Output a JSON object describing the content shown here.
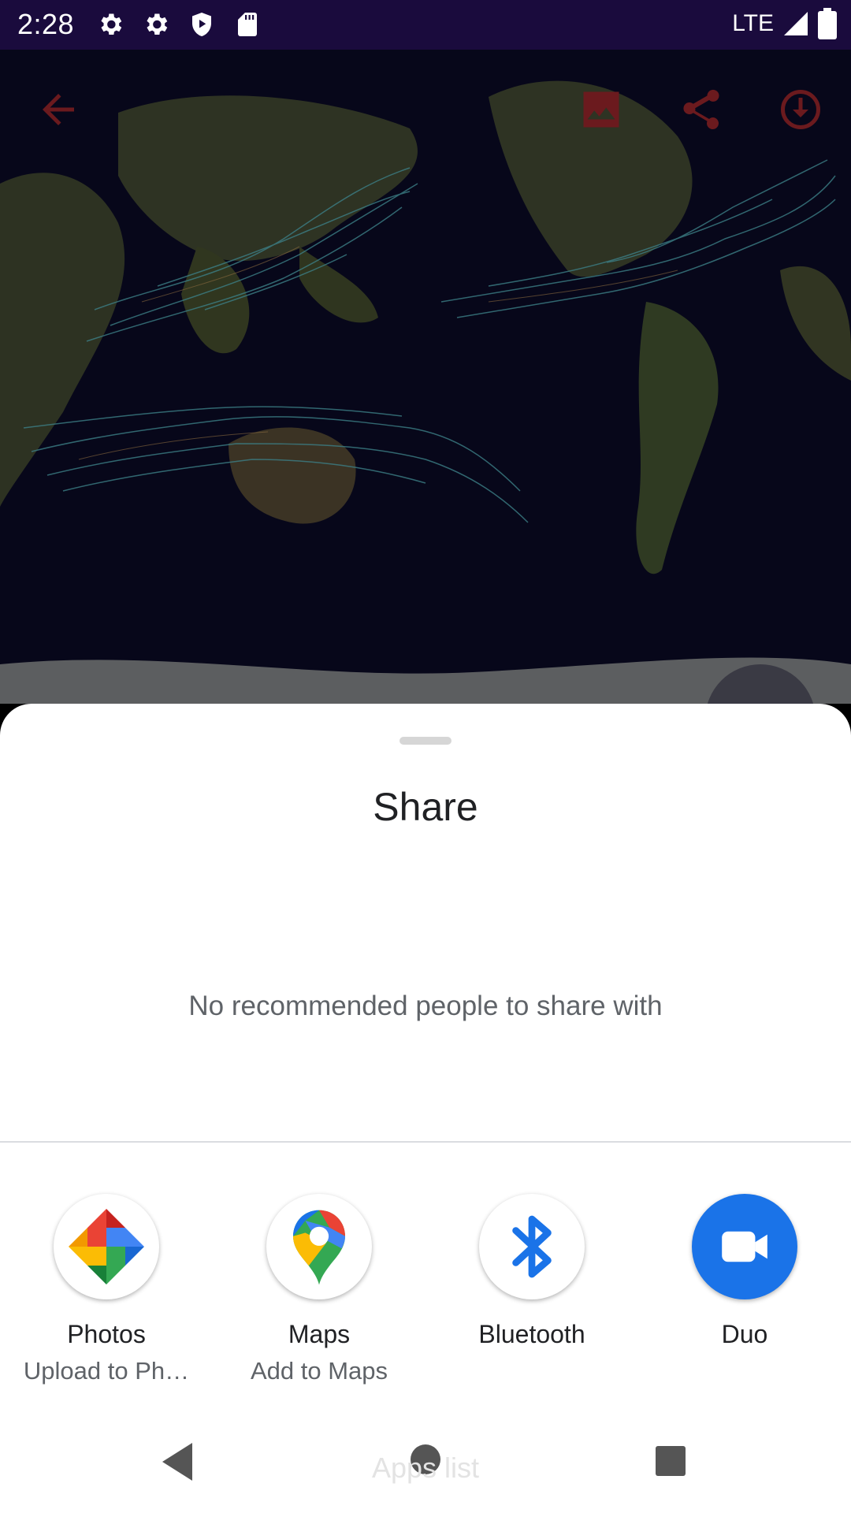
{
  "status_bar": {
    "time": "2:28",
    "network": "LTE",
    "icons": [
      "settings-icon",
      "settings-icon",
      "shield-play-icon",
      "sd-card-icon",
      "signal-icon",
      "battery-icon"
    ]
  },
  "map_toolbar": {
    "icons": [
      "back-arrow-icon",
      "image-icon",
      "share-icon",
      "download-icon"
    ]
  },
  "share_sheet": {
    "title": "Share",
    "empty_message": "No recommended people to share with",
    "apps": [
      {
        "name": "Photos",
        "sub": "Upload to Ph…",
        "icon": "photos-icon"
      },
      {
        "name": "Maps",
        "sub": "Add to Maps",
        "icon": "maps-icon"
      },
      {
        "name": "Bluetooth",
        "sub": "",
        "icon": "bluetooth-icon"
      },
      {
        "name": "Duo",
        "sub": "",
        "icon": "duo-icon"
      }
    ],
    "apps_list_label": "Apps list"
  },
  "colors": {
    "status_bar": "#1a0b3d",
    "toolbar_accent": "#c62828",
    "duo_blue": "#1a73e8"
  }
}
